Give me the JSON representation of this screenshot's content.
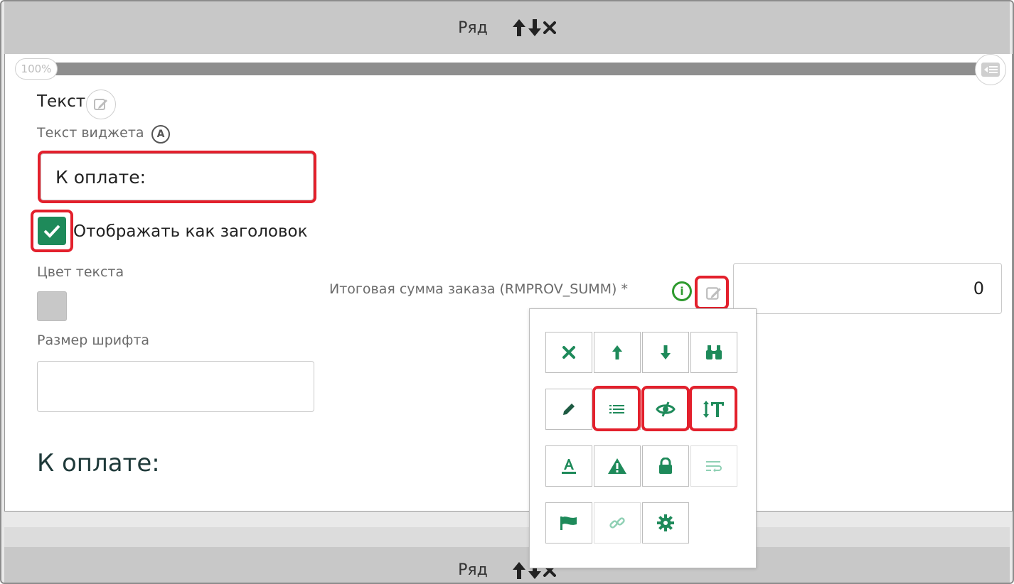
{
  "rows": {
    "top_title": "Ряд",
    "bottom_title": "Ряд"
  },
  "progress": {
    "percent_label": "100%",
    "value": 1.0
  },
  "widget": {
    "title": "Текст",
    "text_label": "Текст виджета",
    "auto_badge": "A",
    "text_value": "К оплате:",
    "show_as_header_label": "Отображать как заголовок",
    "show_as_header_checked": true,
    "text_color_label": "Цвет текста",
    "text_color": "#c8c8c8",
    "font_size_label": "Размер шрифта",
    "font_size_value": "",
    "preview": "К оплате:"
  },
  "field": {
    "label": "Итоговая сумма заказа (RMPROV_SUMM) *",
    "info_icon": "i",
    "value": "0"
  },
  "toolbar": {
    "rows": [
      [
        "delete-icon",
        "move-up-icon",
        "move-down-icon",
        "binoculars-icon"
      ],
      [
        "pencil-icon",
        "list-icon",
        "hide-eye-icon",
        "text-height-icon"
      ],
      [
        "text-color-icon",
        "warning-icon",
        "lock-icon",
        "text-wrap-icon"
      ],
      [
        "flag-icon",
        "link-icon",
        "gear-icon"
      ]
    ]
  },
  "colors": {
    "accent": "#1e8a5a",
    "highlight": "#e3202c",
    "info": "#2e9a2e",
    "header_bg": "#c8c8c8"
  }
}
